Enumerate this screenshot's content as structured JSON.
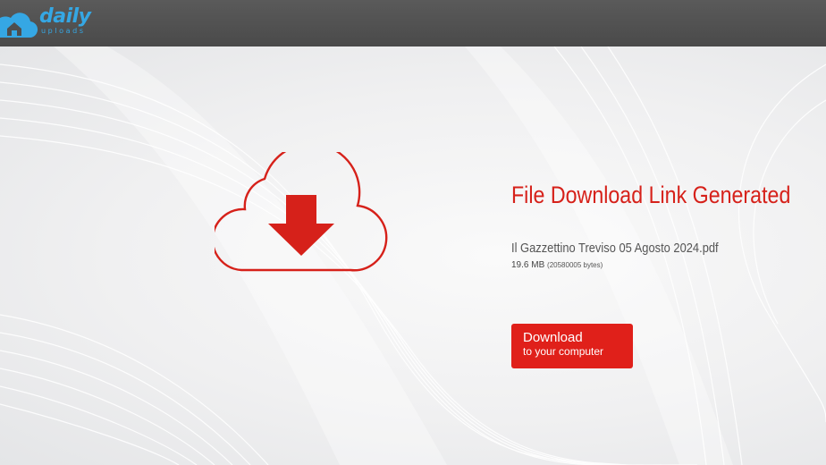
{
  "header": {
    "logo_word": "daily",
    "logo_sub": "uploads"
  },
  "main": {
    "title": "File Download Link Generated",
    "file_name": "Il Gazzettino Treviso 05 Agosto 2024.pdf",
    "file_size": "19.6 MB",
    "file_bytes": "(20580005 bytes)",
    "download_button": {
      "label": "Download",
      "sublabel": "to your computer"
    }
  },
  "colors": {
    "accent": "#e0201a",
    "logo_blue": "#35a7e4",
    "header_bg": "#4e4e4e"
  },
  "icons": {
    "logo": "cloud-house-icon",
    "main": "cloud-download-icon"
  }
}
